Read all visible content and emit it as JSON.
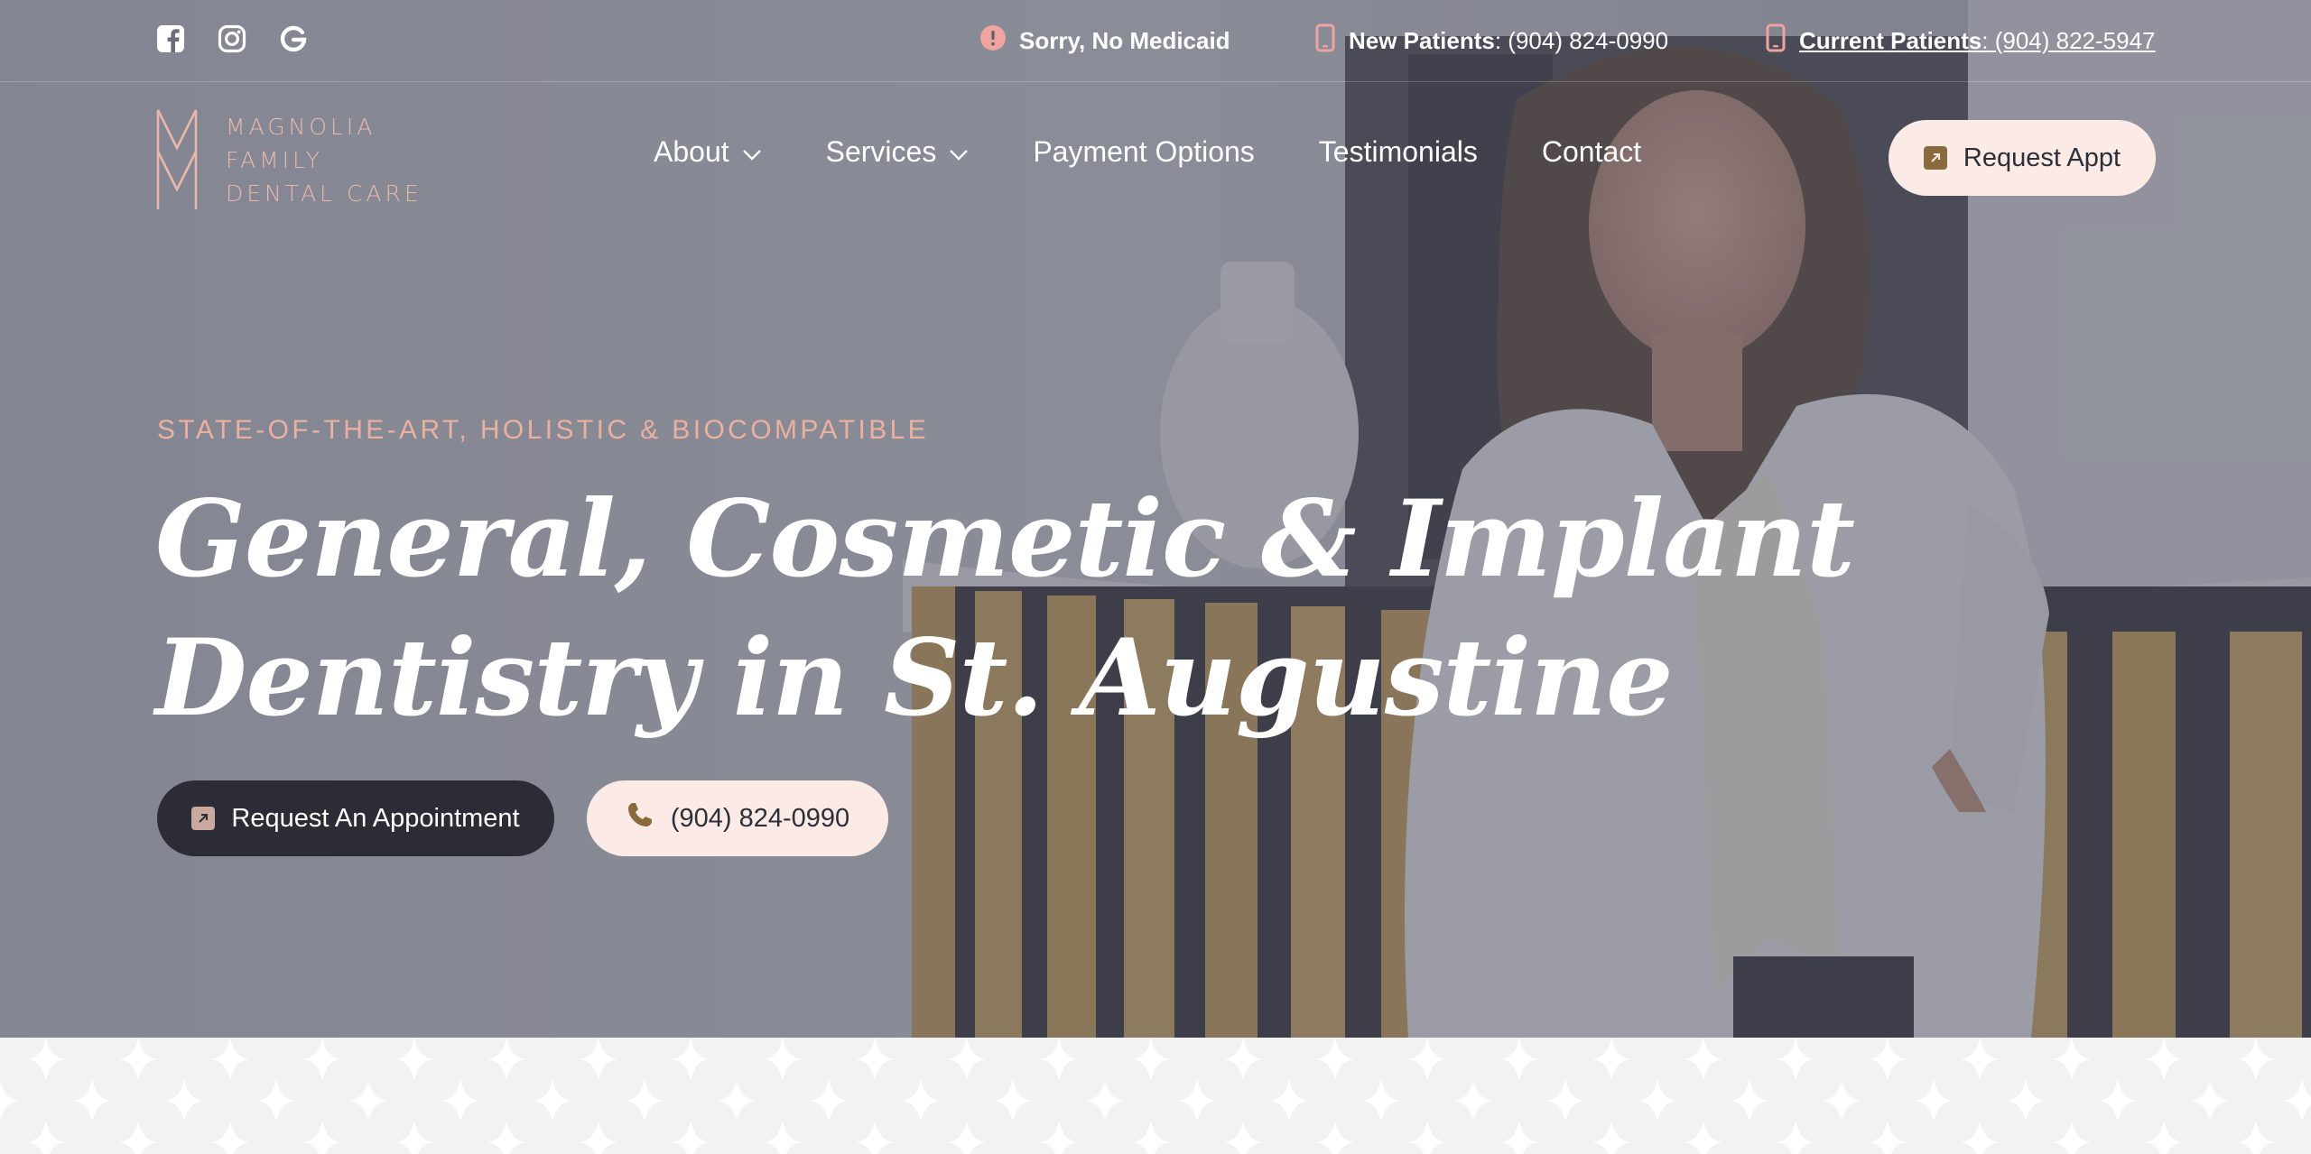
{
  "colors": {
    "accent_pink": "#e8b9ab",
    "button_light": "#fbeae5",
    "button_dark": "#2b2c35",
    "icon_bronze": "#8a6a3d",
    "badge_pink": "#f0a4a0"
  },
  "topbar": {
    "social": [
      {
        "icon": "facebook-icon"
      },
      {
        "icon": "instagram-icon"
      },
      {
        "icon": "google-icon"
      }
    ],
    "notice": {
      "icon": "alert-icon",
      "text": "Sorry, No Medicaid"
    },
    "new_patients": {
      "icon": "phone-icon",
      "label": "New Patients",
      "number": "(904) 824-0990"
    },
    "current_patients": {
      "icon": "phone-icon",
      "label": "Current Patients",
      "number": "(904) 822-5947"
    }
  },
  "logo": {
    "line1": "MAGNOLIA",
    "line2": "FAMILY",
    "line3": "DENTAL CARE"
  },
  "nav": {
    "items": [
      {
        "label": "About",
        "has_dropdown": true
      },
      {
        "label": "Services",
        "has_dropdown": true
      },
      {
        "label": "Payment Options",
        "has_dropdown": false
      },
      {
        "label": "Testimonials",
        "has_dropdown": false
      },
      {
        "label": "Contact",
        "has_dropdown": false
      }
    ],
    "cta": "Request Appt"
  },
  "hero": {
    "eyebrow": "STATE-OF-THE-ART, HOLISTIC & BIOCOMPATIBLE",
    "headline_line1": "General, Cosmetic & Implant",
    "headline_line2": "Dentistry in St. Augustine",
    "primary_button": "Request An Appointment",
    "secondary_button": "(904) 824-0990"
  }
}
